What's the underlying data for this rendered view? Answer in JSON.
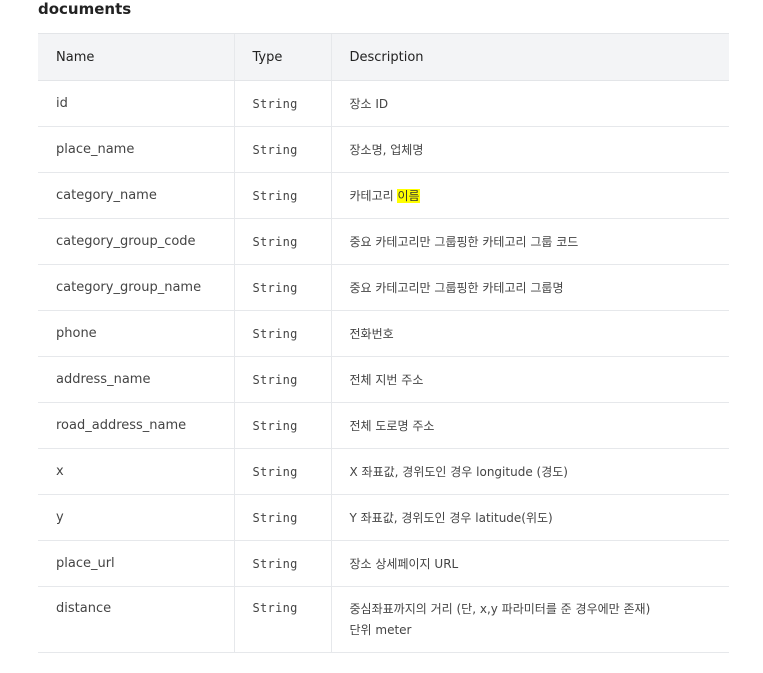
{
  "section_title": "documents",
  "table": {
    "headers": {
      "name": "Name",
      "type": "Type",
      "description": "Description"
    },
    "rows": [
      {
        "name": "id",
        "type": "String",
        "description": "장소 ID"
      },
      {
        "name": "place_name",
        "type": "String",
        "description": "장소명, 업체명"
      },
      {
        "name": "category_name",
        "type": "String",
        "description_prefix": "카테고리 ",
        "description_highlight": "이름"
      },
      {
        "name": "category_group_code",
        "type": "String",
        "description": "중요 카테고리만 그룹핑한 카테고리 그룹 코드"
      },
      {
        "name": "category_group_name",
        "type": "String",
        "description": "중요 카테고리만 그룹핑한 카테고리 그룹명"
      },
      {
        "name": "phone",
        "type": "String",
        "description": "전화번호"
      },
      {
        "name": "address_name",
        "type": "String",
        "description": "전체 지번 주소"
      },
      {
        "name": "road_address_name",
        "type": "String",
        "description": "전체 도로명 주소"
      },
      {
        "name": "x",
        "type": "String",
        "description": "X 좌표값, 경위도인 경우 longitude (경도)"
      },
      {
        "name": "y",
        "type": "String",
        "description": "Y 좌표값, 경위도인 경우 latitude(위도)"
      },
      {
        "name": "place_url",
        "type": "String",
        "description": "장소 상세페이지 URL"
      },
      {
        "name": "distance",
        "type": "String",
        "description_line1": "중심좌표까지의 거리 (단, x,y 파라미터를 준 경우에만 존재)",
        "description_line2": "단위 meter"
      }
    ]
  },
  "colors": {
    "header_bg": "#f3f4f6",
    "border": "#e6e8eb",
    "highlight": "#ffff00"
  }
}
